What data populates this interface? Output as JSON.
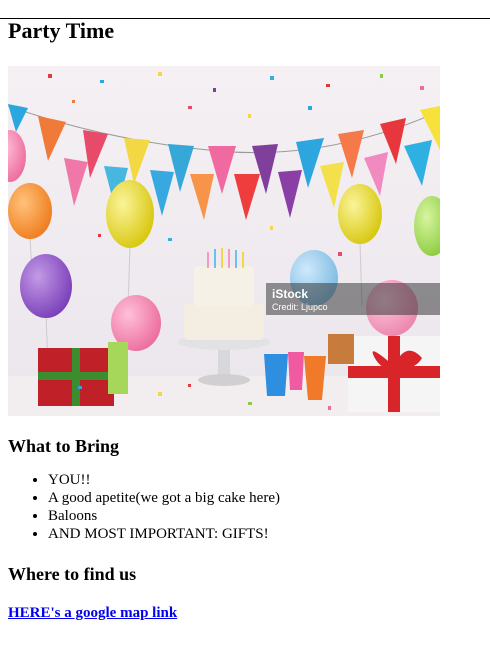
{
  "page": {
    "title": "Party Time"
  },
  "image": {
    "watermark": "iStock",
    "credit": "Credit: Ljupco"
  },
  "bring": {
    "heading": "What to Bring",
    "items": [
      "YOU!!",
      "A good apetite(we got a big cake here)",
      "Baloons",
      "AND MOST IMPORTANT: GIFTS!"
    ]
  },
  "location": {
    "heading": "Where to find us",
    "link_text": "HERE's a google map link"
  }
}
